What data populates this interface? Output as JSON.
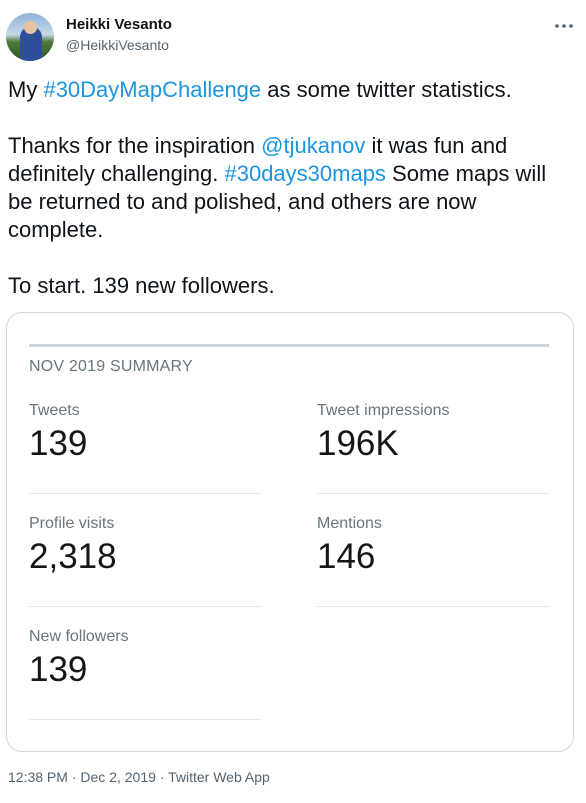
{
  "author": {
    "name": "Heikki Vesanto",
    "handle": "@HeikkiVesanto"
  },
  "more_icon": "more-horizontal-icon",
  "tweet": {
    "line1_pre": "My ",
    "line1_tag": "#30DayMapChallenge",
    "line1_post": " as some twitter statistics.",
    "line2_pre": "Thanks for the inspiration ",
    "line2_mention": "@tjukanov",
    "line2_mid": " it was fun and definitely challenging. ",
    "line2_tag": "#30days30maps",
    "line2_post": " Some maps will be returned to and polished, and others are now complete.",
    "line3": "To start. 139 new followers."
  },
  "summary": {
    "title": "NOV 2019 SUMMARY",
    "tweets_label": "Tweets",
    "tweets_value": "139",
    "impressions_label": "Tweet impressions",
    "impressions_value": "196K",
    "profile_visits_label": "Profile visits",
    "profile_visits_value": "2,318",
    "mentions_label": "Mentions",
    "mentions_value": "146",
    "new_followers_label": "New followers",
    "new_followers_value": "139"
  },
  "footer": {
    "time": "12:38 PM",
    "sep1": " · ",
    "date": "Dec 2, 2019",
    "sep2": " · ",
    "source": "Twitter Web App"
  },
  "colors": {
    "link": "#1b95e0",
    "text": "#0f1419",
    "secondary": "#536471"
  }
}
